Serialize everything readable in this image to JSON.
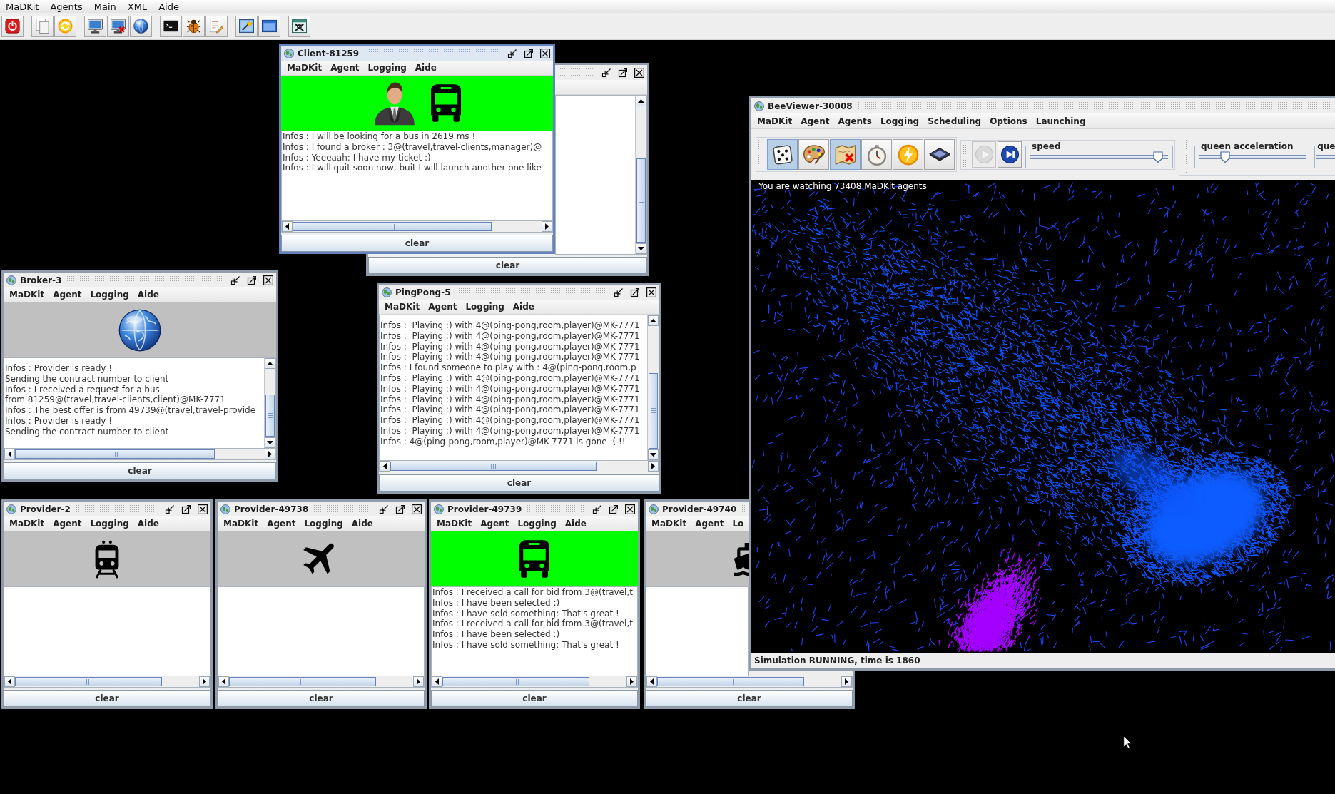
{
  "menu_bar": {
    "items": [
      "MaDKit",
      "Agents",
      "Main",
      "XML",
      "Aide"
    ]
  },
  "toolbar": [
    {
      "buttons": [
        {
          "kind": "power"
        }
      ]
    },
    {
      "buttons": [
        {
          "kind": "pages"
        },
        {
          "kind": "refresh"
        }
      ]
    },
    {
      "buttons": [
        {
          "kind": "monitor"
        },
        {
          "kind": "monitor-x"
        },
        {
          "kind": "globe"
        }
      ]
    },
    {
      "buttons": [
        {
          "kind": "terminal"
        },
        {
          "kind": "bug"
        },
        {
          "kind": "notes"
        }
      ]
    },
    {
      "buttons": [
        {
          "kind": "picture"
        },
        {
          "kind": "window"
        }
      ]
    },
    {
      "buttons": [
        {
          "kind": "crossbones"
        }
      ]
    }
  ],
  "windows": [
    {
      "selected": false,
      "scrollbars": {
        "horizontal": false,
        "vertical": true
      },
      "button": "clear"
    },
    {
      "title": "Client-81259",
      "selected": true,
      "menus": [
        "MaDKit",
        "Agent",
        "Logging",
        "Aide"
      ],
      "banner": {
        "color": "#00ff00",
        "icons": [
          {
            "kind": "person"
          },
          {
            "kind": "bus"
          }
        ]
      },
      "log": [
        "Infos : I will be looking for a bus in 2619 ms !",
        "Infos : I found a broker : 3@(travel,travel-clients,manager)@",
        "Infos : Yeeeaah: I have my ticket :)",
        "Infos : I will quit soon now, buit I will launch another one like"
      ],
      "scrollbars": {
        "horizontal": true,
        "vertical": false
      },
      "button": "clear"
    },
    {
      "title": "Broker-3",
      "selected": false,
      "menus": [
        "MaDKit",
        "Agent",
        "Logging",
        "Aide"
      ],
      "banner": {
        "color": "#c0c0c0",
        "icons": [
          {
            "kind": "globe"
          }
        ]
      },
      "log": [
        "Infos : Provider is ready !",
        "Sending the contract number to client",
        "Infos : I received a request for a bus",
        "from 81259@(travel,travel-clients,client)@MK-7771",
        "Infos : The best offer is from 49739@(travel,travel-provide",
        "Infos : Provider is ready !",
        "Sending the contract number to client"
      ],
      "scrollbars": {
        "horizontal": true,
        "vertical": true
      },
      "button": "clear"
    },
    {
      "title": "PingPong-5",
      "selected": false,
      "menus": [
        "MaDKit",
        "Agent",
        "Logging",
        "Aide"
      ],
      "log": [
        "Infos :  Playing :) with 4@(ping-pong,room,player)@MK-7771",
        "Infos :  Playing :) with 4@(ping-pong,room,player)@MK-7771",
        "Infos :  Playing :) with 4@(ping-pong,room,player)@MK-7771",
        "Infos :  Playing :) with 4@(ping-pong,room,player)@MK-7771",
        "Infos : I found someone to play with : 4@(ping-pong,room,p",
        "Infos :  Playing :) with 4@(ping-pong,room,player)@MK-7771",
        "Infos :  Playing :) with 4@(ping-pong,room,player)@MK-7771",
        "Infos :  Playing :) with 4@(ping-pong,room,player)@MK-7771",
        "Infos :  Playing :) with 4@(ping-pong,room,player)@MK-7771",
        "Infos :  Playing :) with 4@(ping-pong,room,player)@MK-7771",
        "Infos :  Playing :) with 4@(ping-pong,room,player)@MK-7771",
        "Infos : 4@(ping-pong,room,player)@MK-7771 is gone :( !!"
      ],
      "scrollbars": {
        "horizontal": true,
        "vertical": true
      },
      "button": "clear"
    },
    {
      "title": "Provider-2",
      "selected": false,
      "menus": [
        "MaDKit",
        "Agent",
        "Logging",
        "Aide"
      ],
      "banner": {
        "color": "#c0c0c0",
        "icons": [
          {
            "kind": "train"
          }
        ]
      },
      "scrollbars": {
        "horizontal": true,
        "vertical": false
      },
      "button": "clear"
    },
    {
      "title": "Provider-49738",
      "selected": false,
      "menus": [
        "MaDKit",
        "Agent",
        "Logging",
        "Aide"
      ],
      "banner": {
        "color": "#c0c0c0",
        "icons": [
          {
            "kind": "airplane"
          }
        ]
      },
      "scrollbars": {
        "horizontal": true,
        "vertical": false
      },
      "button": "clear"
    },
    {
      "title": "Provider-49739",
      "selected": false,
      "menus": [
        "MaDKit",
        "Agent",
        "Logging",
        "Aide"
      ],
      "banner": {
        "color": "#00ff00",
        "icons": [
          {
            "kind": "bus"
          }
        ]
      },
      "log": [
        "Infos : I received a call for bid from 3@(travel,t",
        "Infos : I have been selected :)",
        "Infos : I have sold something: That's great !",
        "Infos : I received a call for bid from 3@(travel,t",
        "Infos : I have been selected :)",
        "Infos : I have sold something: That's great !"
      ],
      "scrollbars": {
        "horizontal": true,
        "vertical": false
      },
      "button": "clear"
    },
    {
      "title": "Provider-49740",
      "selected": false,
      "menus": [
        "MaDKit",
        "Agent",
        "Lo"
      ],
      "banner": {
        "color": "#c0c0c0",
        "icons": [
          {
            "kind": "ship"
          }
        ]
      },
      "scrollbars": {
        "horizontal": true,
        "vertical": false
      },
      "button": "clear"
    }
  ],
  "bee_viewer": {
    "title": "BeeViewer-30008",
    "selected": false,
    "menus": [
      "MaDKit",
      "Agent",
      "Agents",
      "Logging",
      "Scheduling",
      "Options",
      "Launching"
    ],
    "toolbars": [
      {
        "tools": [
          {
            "kind": "dice",
            "selected": true
          },
          {
            "kind": "palette",
            "selected": false
          },
          {
            "kind": "map",
            "selected": true
          },
          {
            "kind": "stopwatch",
            "selected": false
          },
          {
            "kind": "lightning",
            "selected": false
          },
          {
            "kind": "chip",
            "selected": false
          }
        ]
      },
      {
        "controls": [
          {
            "kind": "play",
            "disabled": true
          },
          {
            "kind": "step",
            "disabled": false
          }
        ],
        "sliders": [
          {
            "label": "speed",
            "level": 0.93
          }
        ]
      },
      {
        "sliders": [
          {
            "label": "queen acceleration",
            "level": 0.24
          },
          {
            "label": "que"
          }
        ]
      }
    ],
    "caption": "You are watching 73408 MaDKit agents",
    "status": "Simulation RUNNING, time is 1860"
  }
}
